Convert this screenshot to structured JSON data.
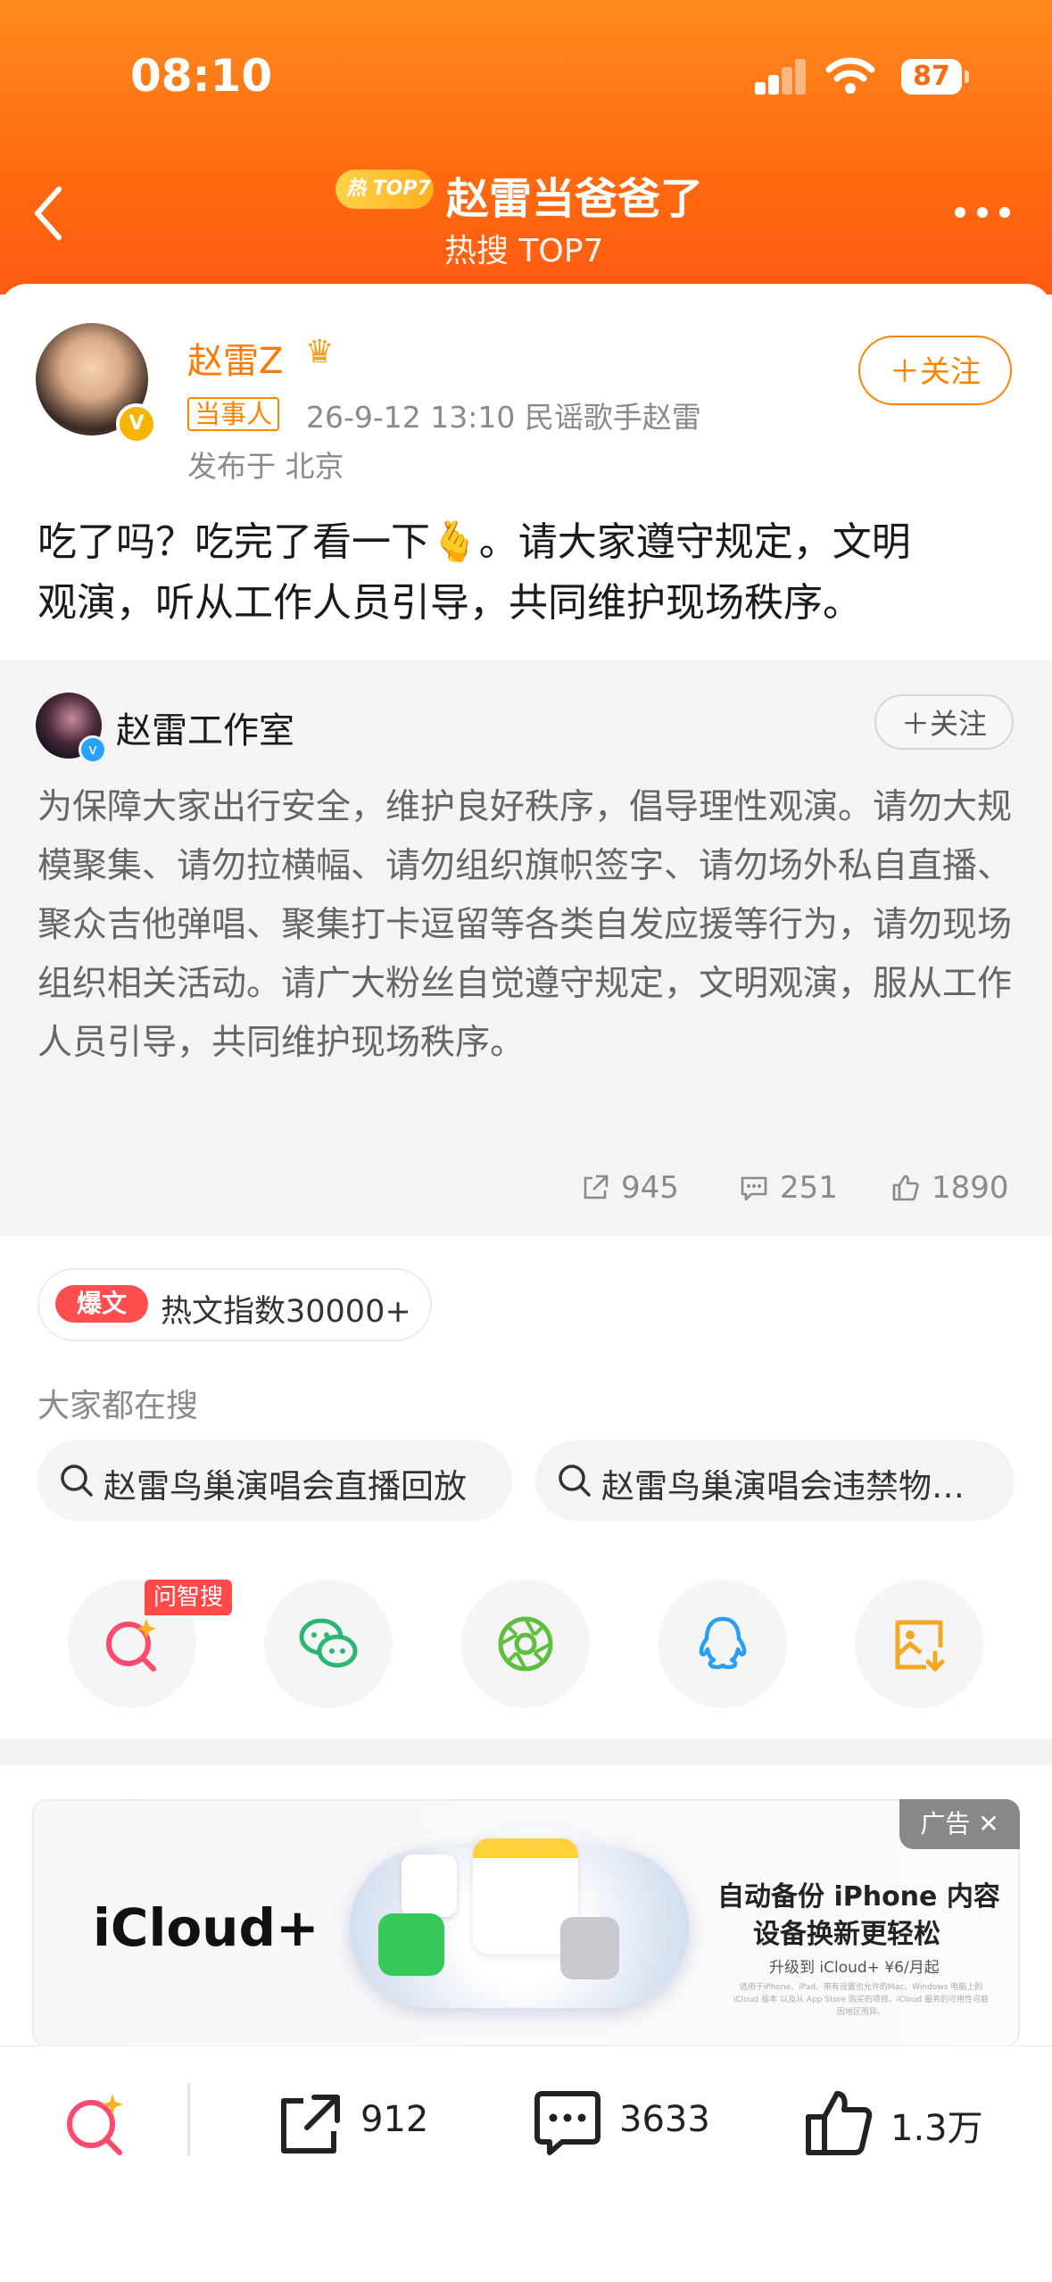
{
  "status_bar": {
    "time": "08:10",
    "battery": "87"
  },
  "header": {
    "badge": "热 TOP7",
    "title": "赵雷当爸爸了",
    "subtitle": "热搜 TOP7"
  },
  "post": {
    "author": "赵雷Z",
    "party_tag": "当事人",
    "meta": "26-9-12 13:10  民谣歌手赵雷",
    "location": "发布于 北京",
    "follow_label": "＋关注",
    "text_line1": "吃了吗？吃完了看一下🫰。请大家遵守规定，文明",
    "text_line2": "观演，听从工作人员引导，共同维护现场秩序。"
  },
  "repost": {
    "author": "赵雷工作室",
    "follow_label": "＋关注",
    "text": "为保障大家出行安全，维护良好秩序，倡导理性观演。请勿大规模聚集、请勿拉横幅、请勿组织旗帜签字、请勿场外私自直播、聚众吉他弹唱、聚集打卡逗留等各类自发应援等行为，请勿现场组织相关活动。请广大粉丝自觉遵守规定，文明观演，服从工作人员引导，共同维护现场秩序。",
    "reposts": "945",
    "comments": "251",
    "likes": "1890"
  },
  "hot_index": {
    "tag": "爆文",
    "text": "热文指数30000+"
  },
  "search": {
    "header": "大家都在搜",
    "items": [
      "赵雷鸟巢演唱会直播回放",
      "赵雷鸟巢演唱会违禁物…"
    ]
  },
  "share": {
    "ai_tag": "问智搜",
    "icons": [
      "ai-search-icon",
      "wechat-icon",
      "moments-icon",
      "qq-icon",
      "save-image-icon"
    ]
  },
  "ad": {
    "label": "广告 ✕",
    "brand": "iCloud+",
    "line1": "自动备份 iPhone 内容",
    "line2": "设备换新更轻松",
    "line3": "升级到 iCloud+ ¥6/月起",
    "fine_print": "适用于iPhone、iPad、带有设置也允许的Mac、Windows 电脑上的 iCloud 版本 以及从 App Store 购买的项目。iCloud 服务的可用性可能因地区而异。"
  },
  "bottom_bar": {
    "reposts": "912",
    "comments": "3633",
    "likes": "1.3万"
  },
  "colors": {
    "brand_orange": "#ff7a00",
    "header_orange": "#ff6a10",
    "hot_red": "#ff4e4e"
  }
}
